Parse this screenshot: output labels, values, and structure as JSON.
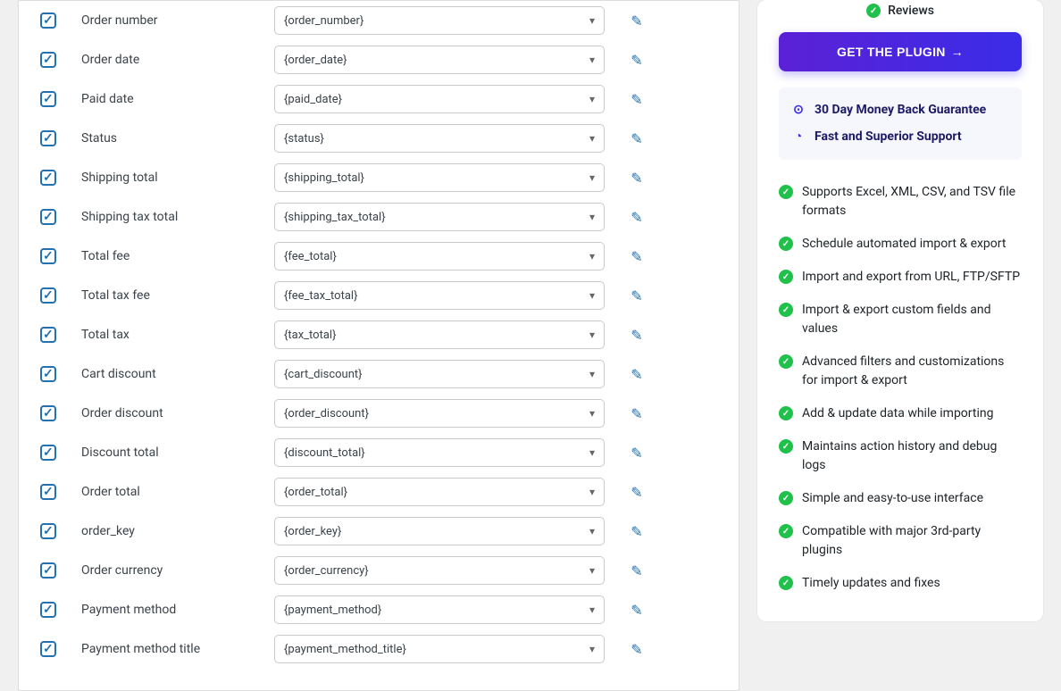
{
  "fields": [
    {
      "label": "Order number",
      "value": "{order_number}"
    },
    {
      "label": "Order date",
      "value": "{order_date}"
    },
    {
      "label": "Paid date",
      "value": "{paid_date}"
    },
    {
      "label": "Status",
      "value": "{status}"
    },
    {
      "label": "Shipping total",
      "value": "{shipping_total}"
    },
    {
      "label": "Shipping tax total",
      "value": "{shipping_tax_total}"
    },
    {
      "label": "Total fee",
      "value": "{fee_total}"
    },
    {
      "label": "Total tax fee",
      "value": "{fee_tax_total}"
    },
    {
      "label": "Total tax",
      "value": "{tax_total}"
    },
    {
      "label": "Cart discount",
      "value": "{cart_discount}"
    },
    {
      "label": "Order discount",
      "value": "{order_discount}"
    },
    {
      "label": "Discount total",
      "value": "{discount_total}"
    },
    {
      "label": "Order total",
      "value": "{order_total}"
    },
    {
      "label": "order_key",
      "value": "{order_key}"
    },
    {
      "label": "Order currency",
      "value": "{order_currency}"
    },
    {
      "label": "Payment method",
      "value": "{payment_method}"
    },
    {
      "label": "Payment method title",
      "value": "{payment_method_title}"
    }
  ],
  "sidebar": {
    "reviews_label": "Reviews",
    "cta_label": "GET THE PLUGIN",
    "guarantees": [
      {
        "icon": "money",
        "text": "30 Day Money Back Guarantee"
      },
      {
        "icon": "support",
        "text": "Fast and Superior Support"
      }
    ],
    "features": [
      "Supports Excel, XML, CSV, and TSV file formats",
      "Schedule automated import & export",
      "Import and export from URL, FTP/SFTP",
      "Import & export custom fields and values",
      "Advanced filters and customizations for import & export",
      "Add & update data while importing",
      "Maintains action history and debug logs",
      "Simple and easy-to-use interface",
      "Compatible with major 3rd-party plugins",
      "Timely updates and fixes"
    ]
  }
}
